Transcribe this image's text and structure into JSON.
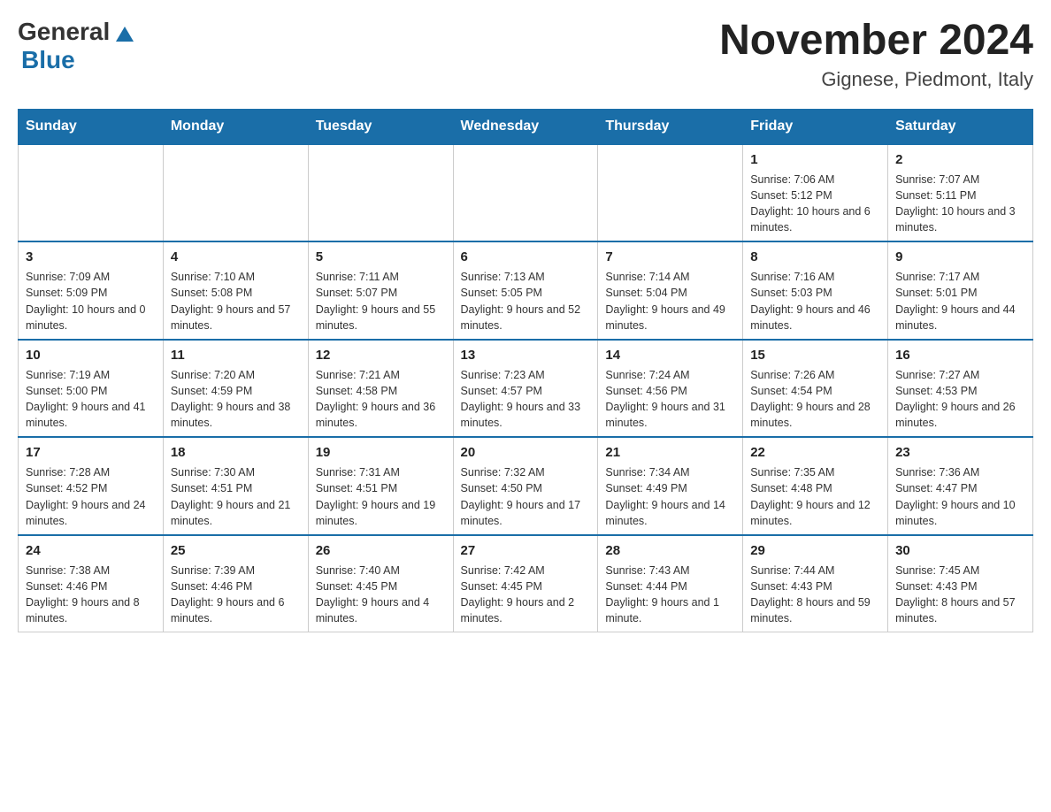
{
  "header": {
    "logo": {
      "general": "General",
      "blue": "Blue",
      "triangle": "▲"
    },
    "title": "November 2024",
    "subtitle": "Gignese, Piedmont, Italy"
  },
  "weekdays": [
    "Sunday",
    "Monday",
    "Tuesday",
    "Wednesday",
    "Thursday",
    "Friday",
    "Saturday"
  ],
  "weeks": [
    [
      null,
      null,
      null,
      null,
      null,
      {
        "day": "1",
        "sunrise": "Sunrise: 7:06 AM",
        "sunset": "Sunset: 5:12 PM",
        "daylight": "Daylight: 10 hours and 6 minutes."
      },
      {
        "day": "2",
        "sunrise": "Sunrise: 7:07 AM",
        "sunset": "Sunset: 5:11 PM",
        "daylight": "Daylight: 10 hours and 3 minutes."
      }
    ],
    [
      {
        "day": "3",
        "sunrise": "Sunrise: 7:09 AM",
        "sunset": "Sunset: 5:09 PM",
        "daylight": "Daylight: 10 hours and 0 minutes."
      },
      {
        "day": "4",
        "sunrise": "Sunrise: 7:10 AM",
        "sunset": "Sunset: 5:08 PM",
        "daylight": "Daylight: 9 hours and 57 minutes."
      },
      {
        "day": "5",
        "sunrise": "Sunrise: 7:11 AM",
        "sunset": "Sunset: 5:07 PM",
        "daylight": "Daylight: 9 hours and 55 minutes."
      },
      {
        "day": "6",
        "sunrise": "Sunrise: 7:13 AM",
        "sunset": "Sunset: 5:05 PM",
        "daylight": "Daylight: 9 hours and 52 minutes."
      },
      {
        "day": "7",
        "sunrise": "Sunrise: 7:14 AM",
        "sunset": "Sunset: 5:04 PM",
        "daylight": "Daylight: 9 hours and 49 minutes."
      },
      {
        "day": "8",
        "sunrise": "Sunrise: 7:16 AM",
        "sunset": "Sunset: 5:03 PM",
        "daylight": "Daylight: 9 hours and 46 minutes."
      },
      {
        "day": "9",
        "sunrise": "Sunrise: 7:17 AM",
        "sunset": "Sunset: 5:01 PM",
        "daylight": "Daylight: 9 hours and 44 minutes."
      }
    ],
    [
      {
        "day": "10",
        "sunrise": "Sunrise: 7:19 AM",
        "sunset": "Sunset: 5:00 PM",
        "daylight": "Daylight: 9 hours and 41 minutes."
      },
      {
        "day": "11",
        "sunrise": "Sunrise: 7:20 AM",
        "sunset": "Sunset: 4:59 PM",
        "daylight": "Daylight: 9 hours and 38 minutes."
      },
      {
        "day": "12",
        "sunrise": "Sunrise: 7:21 AM",
        "sunset": "Sunset: 4:58 PM",
        "daylight": "Daylight: 9 hours and 36 minutes."
      },
      {
        "day": "13",
        "sunrise": "Sunrise: 7:23 AM",
        "sunset": "Sunset: 4:57 PM",
        "daylight": "Daylight: 9 hours and 33 minutes."
      },
      {
        "day": "14",
        "sunrise": "Sunrise: 7:24 AM",
        "sunset": "Sunset: 4:56 PM",
        "daylight": "Daylight: 9 hours and 31 minutes."
      },
      {
        "day": "15",
        "sunrise": "Sunrise: 7:26 AM",
        "sunset": "Sunset: 4:54 PM",
        "daylight": "Daylight: 9 hours and 28 minutes."
      },
      {
        "day": "16",
        "sunrise": "Sunrise: 7:27 AM",
        "sunset": "Sunset: 4:53 PM",
        "daylight": "Daylight: 9 hours and 26 minutes."
      }
    ],
    [
      {
        "day": "17",
        "sunrise": "Sunrise: 7:28 AM",
        "sunset": "Sunset: 4:52 PM",
        "daylight": "Daylight: 9 hours and 24 minutes."
      },
      {
        "day": "18",
        "sunrise": "Sunrise: 7:30 AM",
        "sunset": "Sunset: 4:51 PM",
        "daylight": "Daylight: 9 hours and 21 minutes."
      },
      {
        "day": "19",
        "sunrise": "Sunrise: 7:31 AM",
        "sunset": "Sunset: 4:51 PM",
        "daylight": "Daylight: 9 hours and 19 minutes."
      },
      {
        "day": "20",
        "sunrise": "Sunrise: 7:32 AM",
        "sunset": "Sunset: 4:50 PM",
        "daylight": "Daylight: 9 hours and 17 minutes."
      },
      {
        "day": "21",
        "sunrise": "Sunrise: 7:34 AM",
        "sunset": "Sunset: 4:49 PM",
        "daylight": "Daylight: 9 hours and 14 minutes."
      },
      {
        "day": "22",
        "sunrise": "Sunrise: 7:35 AM",
        "sunset": "Sunset: 4:48 PM",
        "daylight": "Daylight: 9 hours and 12 minutes."
      },
      {
        "day": "23",
        "sunrise": "Sunrise: 7:36 AM",
        "sunset": "Sunset: 4:47 PM",
        "daylight": "Daylight: 9 hours and 10 minutes."
      }
    ],
    [
      {
        "day": "24",
        "sunrise": "Sunrise: 7:38 AM",
        "sunset": "Sunset: 4:46 PM",
        "daylight": "Daylight: 9 hours and 8 minutes."
      },
      {
        "day": "25",
        "sunrise": "Sunrise: 7:39 AM",
        "sunset": "Sunset: 4:46 PM",
        "daylight": "Daylight: 9 hours and 6 minutes."
      },
      {
        "day": "26",
        "sunrise": "Sunrise: 7:40 AM",
        "sunset": "Sunset: 4:45 PM",
        "daylight": "Daylight: 9 hours and 4 minutes."
      },
      {
        "day": "27",
        "sunrise": "Sunrise: 7:42 AM",
        "sunset": "Sunset: 4:45 PM",
        "daylight": "Daylight: 9 hours and 2 minutes."
      },
      {
        "day": "28",
        "sunrise": "Sunrise: 7:43 AM",
        "sunset": "Sunset: 4:44 PM",
        "daylight": "Daylight: 9 hours and 1 minute."
      },
      {
        "day": "29",
        "sunrise": "Sunrise: 7:44 AM",
        "sunset": "Sunset: 4:43 PM",
        "daylight": "Daylight: 8 hours and 59 minutes."
      },
      {
        "day": "30",
        "sunrise": "Sunrise: 7:45 AM",
        "sunset": "Sunset: 4:43 PM",
        "daylight": "Daylight: 8 hours and 57 minutes."
      }
    ]
  ]
}
